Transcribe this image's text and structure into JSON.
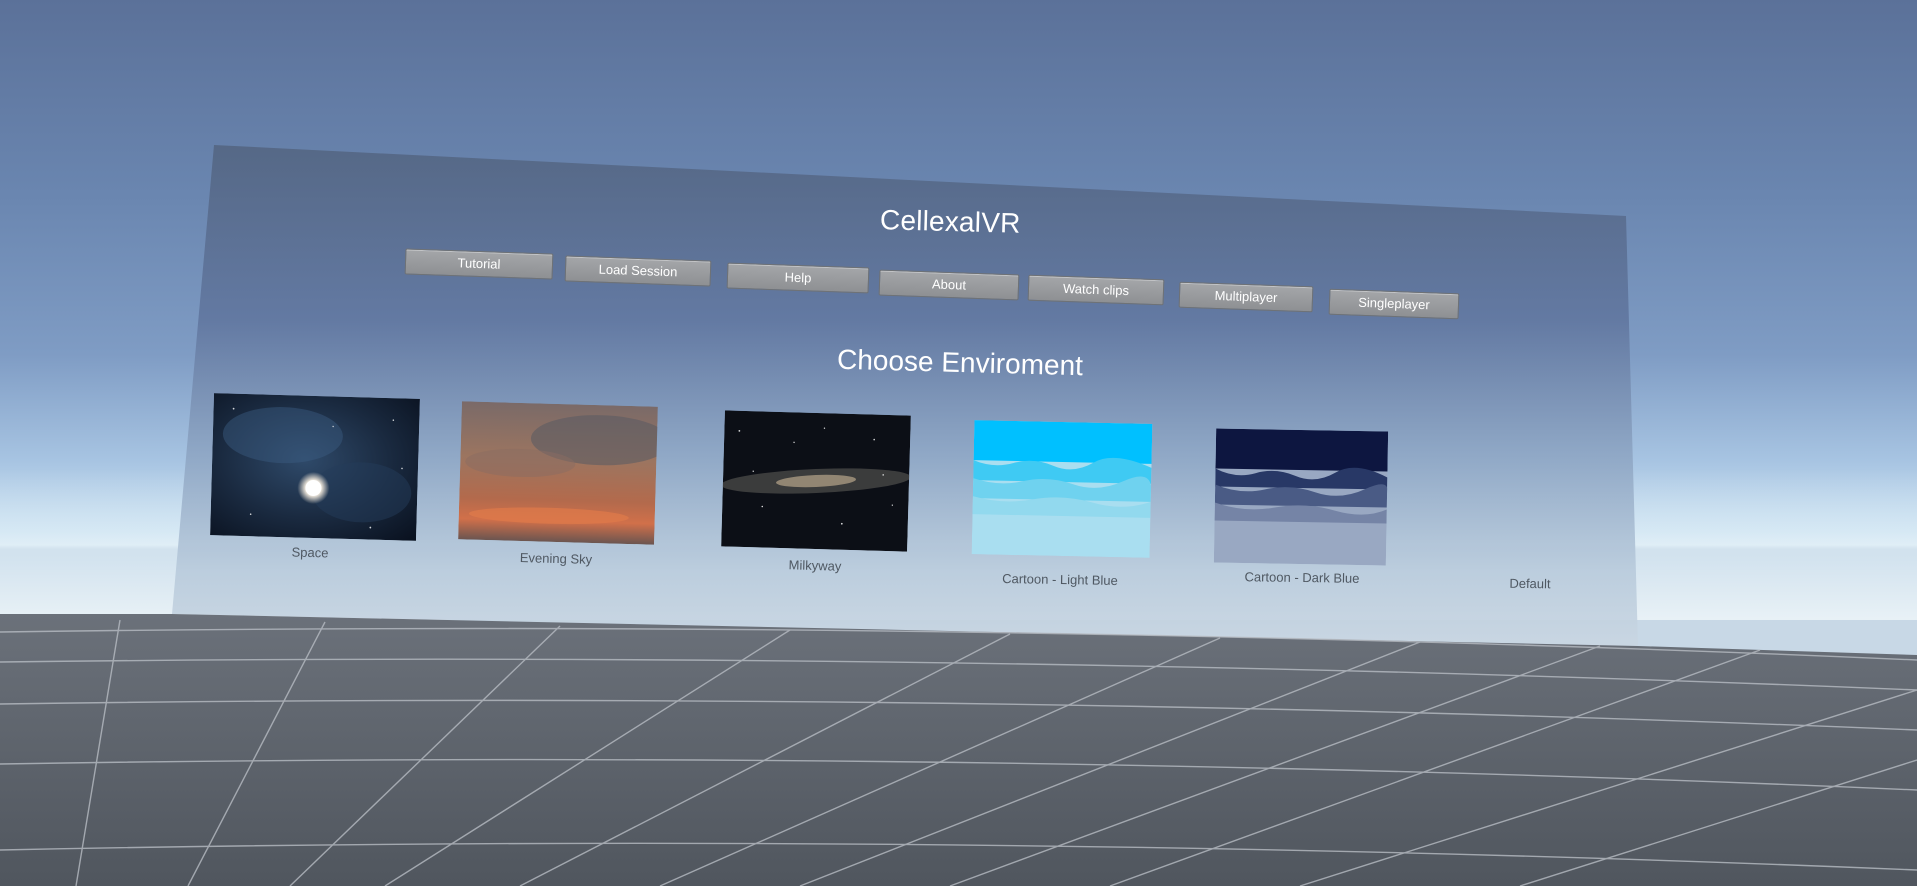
{
  "app": {
    "title": "CellexalVR"
  },
  "menu": {
    "buttons": [
      {
        "label": "Tutorial"
      },
      {
        "label": "Load Session"
      },
      {
        "label": "Help"
      },
      {
        "label": "About"
      },
      {
        "label": "Watch clips"
      },
      {
        "label": "Multiplayer"
      },
      {
        "label": "Singleplayer"
      }
    ]
  },
  "environments": {
    "heading": "Choose Enviroment",
    "items": [
      {
        "label": "Space",
        "icon": "space-preview"
      },
      {
        "label": "Evening Sky",
        "icon": "evening-sky-preview"
      },
      {
        "label": "Milkyway",
        "icon": "milkyway-preview"
      },
      {
        "label": "Cartoon - Light Blue",
        "icon": "cartoon-light-blue-preview"
      },
      {
        "label": "Cartoon - Dark Blue",
        "icon": "cartoon-dark-blue-preview"
      },
      {
        "label": "Default",
        "icon": ""
      }
    ]
  },
  "colors": {
    "sky_top": "#5b7199",
    "panel": "#5e7190",
    "floor": "#5d636b",
    "grid_line": "#b7bcc3",
    "button": "#9a9c9f",
    "label_text": "#4f5862"
  }
}
